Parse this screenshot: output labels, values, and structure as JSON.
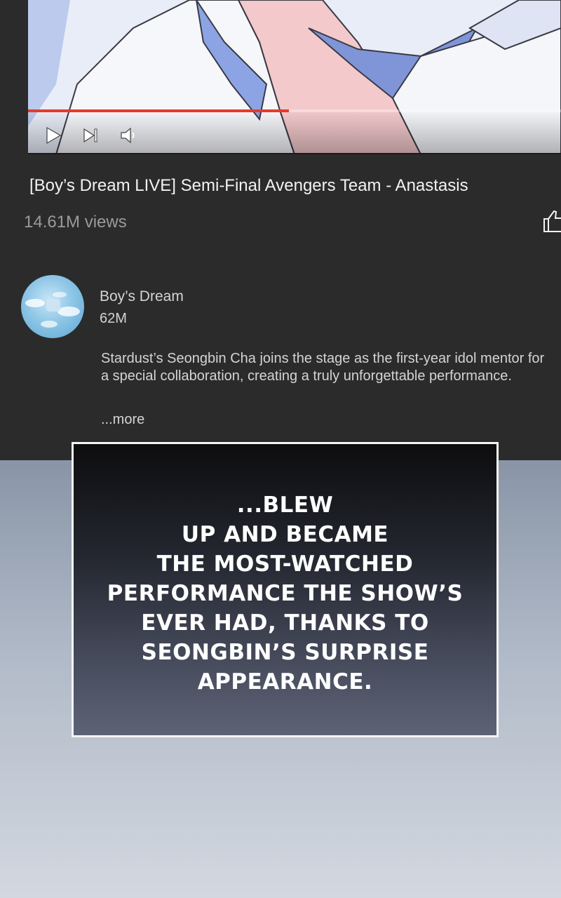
{
  "player": {
    "progress": 0.49,
    "play_icon": "play-icon",
    "next_icon": "skip-next-icon",
    "volume_icon": "volume-icon",
    "accent_color": "#e53a2b"
  },
  "video": {
    "title": "[Boy’s Dream LIVE] Semi-Final Avengers Team - Anastasis",
    "views": "14.61M views",
    "like_icon": "thumbs-up-icon"
  },
  "channel": {
    "name": "Boy’s Dream",
    "subscribers": "62M",
    "description": "Stardust’s Seongbin Cha joins the stage as the first-year idol mentor for a special collaboration, creating a truly unforgettable performance.",
    "more_label": "...more"
  },
  "caption": {
    "lines": [
      "...Blew",
      "up and became",
      "the most-watched",
      "performance the show’s",
      "ever had, thanks to",
      "Seongbin’s surprise",
      "appearance."
    ]
  }
}
